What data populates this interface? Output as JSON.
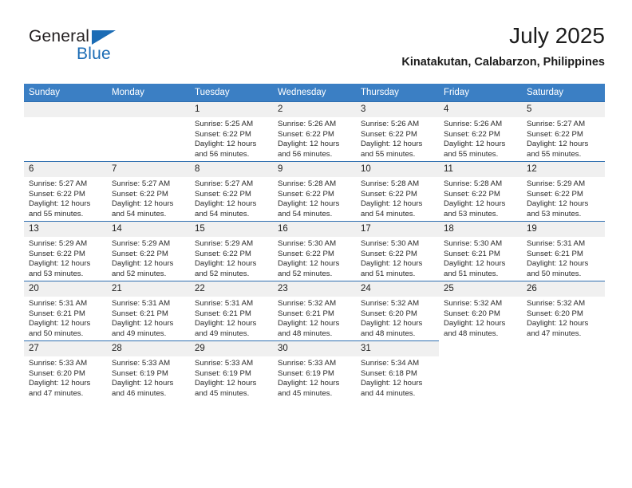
{
  "brand": {
    "name_top": "General",
    "name_bottom": "Blue",
    "accent_color": "#1b6cb5"
  },
  "header": {
    "title": "July 2025",
    "location": "Kinatakutan, Calabarzon, Philippines"
  },
  "calendar": {
    "header_bg": "#3b7fc4",
    "row_line_color": "#2f6fb0",
    "daynum_bg": "#f0f0f0",
    "weekdays": [
      "Sunday",
      "Monday",
      "Tuesday",
      "Wednesday",
      "Thursday",
      "Friday",
      "Saturday"
    ],
    "weeks": [
      [
        {
          "day": "",
          "lines": []
        },
        {
          "day": "",
          "lines": []
        },
        {
          "day": "1",
          "lines": [
            "Sunrise: 5:25 AM",
            "Sunset: 6:22 PM",
            "Daylight: 12 hours",
            "and 56 minutes."
          ]
        },
        {
          "day": "2",
          "lines": [
            "Sunrise: 5:26 AM",
            "Sunset: 6:22 PM",
            "Daylight: 12 hours",
            "and 56 minutes."
          ]
        },
        {
          "day": "3",
          "lines": [
            "Sunrise: 5:26 AM",
            "Sunset: 6:22 PM",
            "Daylight: 12 hours",
            "and 55 minutes."
          ]
        },
        {
          "day": "4",
          "lines": [
            "Sunrise: 5:26 AM",
            "Sunset: 6:22 PM",
            "Daylight: 12 hours",
            "and 55 minutes."
          ]
        },
        {
          "day": "5",
          "lines": [
            "Sunrise: 5:27 AM",
            "Sunset: 6:22 PM",
            "Daylight: 12 hours",
            "and 55 minutes."
          ]
        }
      ],
      [
        {
          "day": "6",
          "lines": [
            "Sunrise: 5:27 AM",
            "Sunset: 6:22 PM",
            "Daylight: 12 hours",
            "and 55 minutes."
          ]
        },
        {
          "day": "7",
          "lines": [
            "Sunrise: 5:27 AM",
            "Sunset: 6:22 PM",
            "Daylight: 12 hours",
            "and 54 minutes."
          ]
        },
        {
          "day": "8",
          "lines": [
            "Sunrise: 5:27 AM",
            "Sunset: 6:22 PM",
            "Daylight: 12 hours",
            "and 54 minutes."
          ]
        },
        {
          "day": "9",
          "lines": [
            "Sunrise: 5:28 AM",
            "Sunset: 6:22 PM",
            "Daylight: 12 hours",
            "and 54 minutes."
          ]
        },
        {
          "day": "10",
          "lines": [
            "Sunrise: 5:28 AM",
            "Sunset: 6:22 PM",
            "Daylight: 12 hours",
            "and 54 minutes."
          ]
        },
        {
          "day": "11",
          "lines": [
            "Sunrise: 5:28 AM",
            "Sunset: 6:22 PM",
            "Daylight: 12 hours",
            "and 53 minutes."
          ]
        },
        {
          "day": "12",
          "lines": [
            "Sunrise: 5:29 AM",
            "Sunset: 6:22 PM",
            "Daylight: 12 hours",
            "and 53 minutes."
          ]
        }
      ],
      [
        {
          "day": "13",
          "lines": [
            "Sunrise: 5:29 AM",
            "Sunset: 6:22 PM",
            "Daylight: 12 hours",
            "and 53 minutes."
          ]
        },
        {
          "day": "14",
          "lines": [
            "Sunrise: 5:29 AM",
            "Sunset: 6:22 PM",
            "Daylight: 12 hours",
            "and 52 minutes."
          ]
        },
        {
          "day": "15",
          "lines": [
            "Sunrise: 5:29 AM",
            "Sunset: 6:22 PM",
            "Daylight: 12 hours",
            "and 52 minutes."
          ]
        },
        {
          "day": "16",
          "lines": [
            "Sunrise: 5:30 AM",
            "Sunset: 6:22 PM",
            "Daylight: 12 hours",
            "and 52 minutes."
          ]
        },
        {
          "day": "17",
          "lines": [
            "Sunrise: 5:30 AM",
            "Sunset: 6:22 PM",
            "Daylight: 12 hours",
            "and 51 minutes."
          ]
        },
        {
          "day": "18",
          "lines": [
            "Sunrise: 5:30 AM",
            "Sunset: 6:21 PM",
            "Daylight: 12 hours",
            "and 51 minutes."
          ]
        },
        {
          "day": "19",
          "lines": [
            "Sunrise: 5:31 AM",
            "Sunset: 6:21 PM",
            "Daylight: 12 hours",
            "and 50 minutes."
          ]
        }
      ],
      [
        {
          "day": "20",
          "lines": [
            "Sunrise: 5:31 AM",
            "Sunset: 6:21 PM",
            "Daylight: 12 hours",
            "and 50 minutes."
          ]
        },
        {
          "day": "21",
          "lines": [
            "Sunrise: 5:31 AM",
            "Sunset: 6:21 PM",
            "Daylight: 12 hours",
            "and 49 minutes."
          ]
        },
        {
          "day": "22",
          "lines": [
            "Sunrise: 5:31 AM",
            "Sunset: 6:21 PM",
            "Daylight: 12 hours",
            "and 49 minutes."
          ]
        },
        {
          "day": "23",
          "lines": [
            "Sunrise: 5:32 AM",
            "Sunset: 6:21 PM",
            "Daylight: 12 hours",
            "and 48 minutes."
          ]
        },
        {
          "day": "24",
          "lines": [
            "Sunrise: 5:32 AM",
            "Sunset: 6:20 PM",
            "Daylight: 12 hours",
            "and 48 minutes."
          ]
        },
        {
          "day": "25",
          "lines": [
            "Sunrise: 5:32 AM",
            "Sunset: 6:20 PM",
            "Daylight: 12 hours",
            "and 48 minutes."
          ]
        },
        {
          "day": "26",
          "lines": [
            "Sunrise: 5:32 AM",
            "Sunset: 6:20 PM",
            "Daylight: 12 hours",
            "and 47 minutes."
          ]
        }
      ],
      [
        {
          "day": "27",
          "lines": [
            "Sunrise: 5:33 AM",
            "Sunset: 6:20 PM",
            "Daylight: 12 hours",
            "and 47 minutes."
          ]
        },
        {
          "day": "28",
          "lines": [
            "Sunrise: 5:33 AM",
            "Sunset: 6:19 PM",
            "Daylight: 12 hours",
            "and 46 minutes."
          ]
        },
        {
          "day": "29",
          "lines": [
            "Sunrise: 5:33 AM",
            "Sunset: 6:19 PM",
            "Daylight: 12 hours",
            "and 45 minutes."
          ]
        },
        {
          "day": "30",
          "lines": [
            "Sunrise: 5:33 AM",
            "Sunset: 6:19 PM",
            "Daylight: 12 hours",
            "and 45 minutes."
          ]
        },
        {
          "day": "31",
          "lines": [
            "Sunrise: 5:34 AM",
            "Sunset: 6:18 PM",
            "Daylight: 12 hours",
            "and 44 minutes."
          ]
        },
        {
          "day": "",
          "lines": []
        },
        {
          "day": "",
          "lines": []
        }
      ]
    ]
  }
}
